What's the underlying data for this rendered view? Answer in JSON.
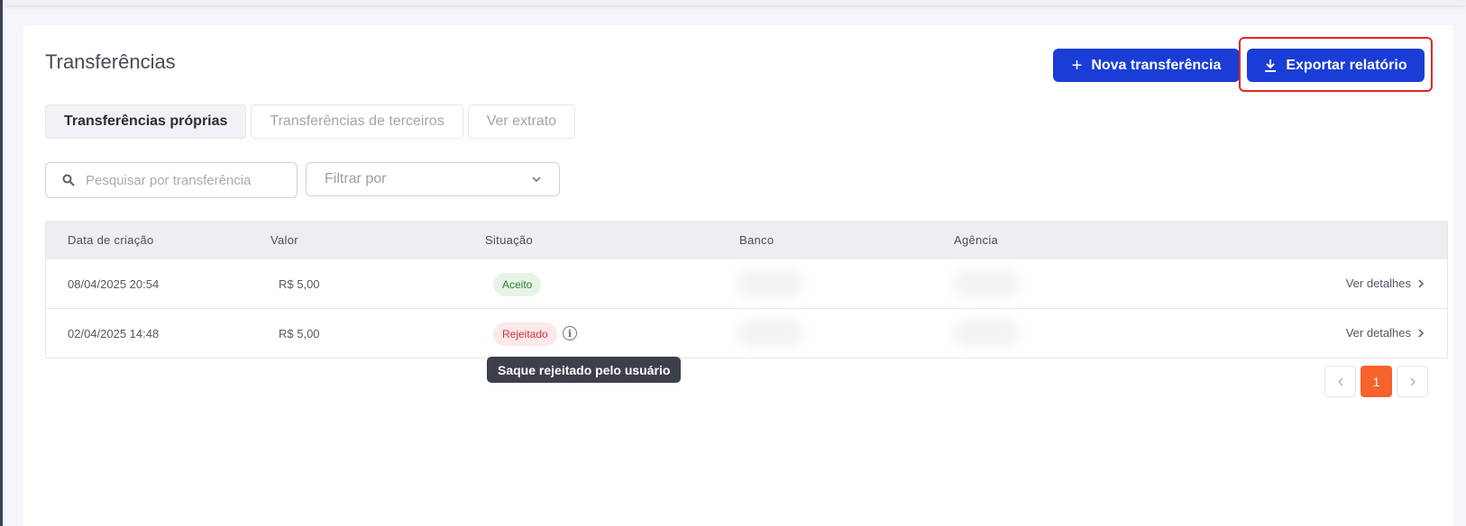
{
  "page": {
    "title": "Transferências"
  },
  "actions": {
    "new_transfer": "Nova transferência",
    "export_report": "Exportar relatório"
  },
  "tabs": [
    {
      "label": "Transferências próprias",
      "active": true
    },
    {
      "label": "Transferências de terceiros",
      "active": false
    },
    {
      "label": "Ver extrato",
      "active": false
    }
  ],
  "search": {
    "placeholder": "Pesquisar por transferência",
    "value": ""
  },
  "filter": {
    "label": "Filtrar por"
  },
  "table": {
    "columns": [
      "Data de criação",
      "Valor",
      "Situação",
      "Banco",
      "Agência"
    ],
    "rows": [
      {
        "date": "08/04/2025 20:54",
        "value": "R$ 5,00",
        "status": "Aceito",
        "details": "Ver detalhes"
      },
      {
        "date": "02/04/2025 14:48",
        "value": "R$ 5,00",
        "status": "Rejeitado",
        "details": "Ver detalhes"
      }
    ]
  },
  "tooltip": {
    "text": "Saque rejeitado pelo usuário"
  },
  "pagination": {
    "current": "1"
  },
  "colors": {
    "primary": "#1a3dd6",
    "accent": "#f5622c",
    "highlight": "#e02828"
  }
}
